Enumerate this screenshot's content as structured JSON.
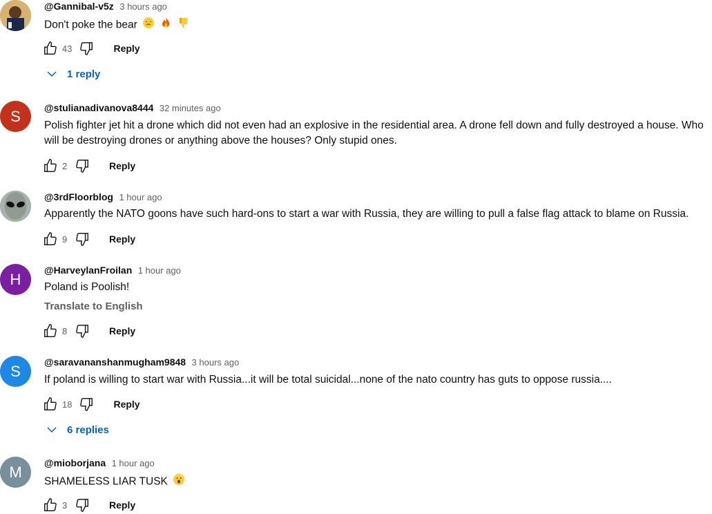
{
  "comments": [
    {
      "author": "@Gannibal-v5z",
      "time": "3 hours ago",
      "text": "Don't poke the bear",
      "likes": "43",
      "reply_label": "Reply",
      "replies_label": "1 reply"
    },
    {
      "author": "@stulianadivanova8444",
      "time": "32 minutes ago",
      "text": "Polish fighter jet hit a drone which did not even had an explosive in the residential area. A drone fell down and fully destroyed a house. Who will be destroying drones or anything above the houses? Only stupid ones.",
      "avatar_letter": "S",
      "avatar_color": "#c4311b",
      "likes": "2",
      "reply_label": "Reply"
    },
    {
      "author": "@3rdFloorblog",
      "time": "1 hour ago",
      "text": "Apparently the NATO goons have such hard-ons to start a war with Russia, they are willing to pull a false flag attack to blame on Russia.",
      "likes": "9",
      "reply_label": "Reply"
    },
    {
      "author": "@HarveylanFroilan",
      "time": "1 hour ago",
      "text": "Poland is Poolish!",
      "translate_label": "Translate to English",
      "avatar_letter": "H",
      "avatar_color": "#7b1fa2",
      "likes": "8",
      "reply_label": "Reply"
    },
    {
      "author": "@saravananshanmugham9848",
      "time": "3 hours ago",
      "text": "If poland is willing to start war with Russia...it will be total suicidal...none of the nato country has guts to oppose russia....",
      "avatar_letter": "S",
      "avatar_color": "#1e88e5",
      "likes": "18",
      "reply_label": "Reply",
      "replies_label": "6 replies"
    },
    {
      "author": "@mioborjana",
      "time": "1 hour ago",
      "text": "SHAMELESS LIAR TUSK",
      "avatar_letter": "M",
      "avatar_color": "#78909c",
      "likes": "3",
      "reply_label": "Reply"
    }
  ],
  "colors": {
    "link": "#065fd4",
    "secondary_text": "#606060"
  },
  "icons": [
    "thumb-up-icon",
    "thumb-down-icon",
    "chevron-down-icon",
    "emoji"
  ]
}
